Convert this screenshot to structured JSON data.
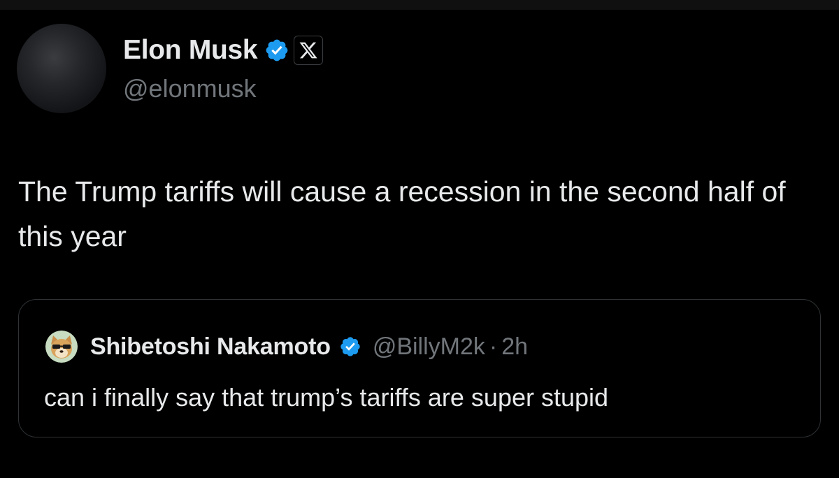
{
  "tweet": {
    "author": {
      "name": "Elon Musk",
      "handle": "@elonmusk",
      "verified": true,
      "affiliate_badge_icon": "x-logo-icon"
    },
    "text": "The Trump tariffs will cause a recession in the second half of this year"
  },
  "quoted": {
    "author": {
      "name": "Shibetoshi Nakamoto",
      "handle": "@BillyM2k",
      "verified": true
    },
    "separator": "·",
    "time": "2h",
    "text": "can i finally say that trump’s tariffs are super stupid"
  },
  "colors": {
    "background": "#000000",
    "text_primary": "#e7e9ea",
    "text_secondary": "#71767b",
    "verified_blue": "#1d9bf0",
    "border": "#2f3336"
  }
}
